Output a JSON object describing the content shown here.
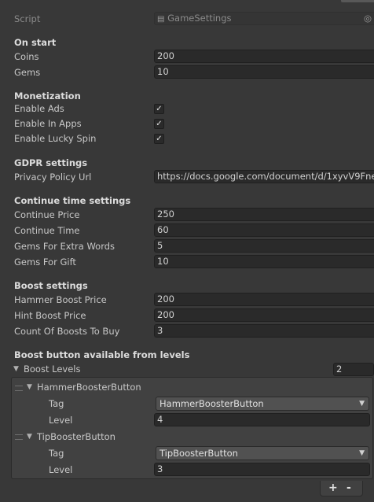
{
  "script_row": {
    "label": "Script",
    "value": "GameSettings"
  },
  "on_start": {
    "header": "On start",
    "coins": {
      "label": "Coins",
      "value": "200"
    },
    "gems": {
      "label": "Gems",
      "value": "10"
    }
  },
  "monetization": {
    "header": "Monetization",
    "enable_ads": {
      "label": "Enable Ads",
      "checked": true
    },
    "enable_in_apps": {
      "label": "Enable In Apps",
      "checked": true
    },
    "enable_lucky_spin": {
      "label": "Enable Lucky Spin",
      "checked": true
    }
  },
  "gdpr": {
    "header": "GDPR settings",
    "privacy_policy_url": {
      "label": "Privacy Policy Url",
      "value": "https://docs.google.com/document/d/1xyvV9Fne"
    }
  },
  "continue_time": {
    "header": "Continue time settings",
    "continue_price": {
      "label": "Continue Price",
      "value": "250"
    },
    "continue_time": {
      "label": "Continue Time",
      "value": "60"
    },
    "gems_for_extra_words": {
      "label": "Gems For Extra Words",
      "value": "5"
    },
    "gems_for_gift": {
      "label": "Gems For Gift",
      "value": "10"
    }
  },
  "boost": {
    "header": "Boost settings",
    "hammer_boost_price": {
      "label": "Hammer Boost Price",
      "value": "200"
    },
    "hint_boost_price": {
      "label": "Hint Boost Price",
      "value": "200"
    },
    "count_of_boosts_to_buy": {
      "label": "Count Of Boosts To Buy",
      "value": "3"
    }
  },
  "boost_levels": {
    "header": "Boost button available from levels",
    "list_label": "Boost Levels",
    "size": "2",
    "items": [
      {
        "name": "HammerBoosterButton",
        "tag_label": "Tag",
        "tag_value": "HammerBoosterButton",
        "level_label": "Level",
        "level_value": "4"
      },
      {
        "name": "TipBoosterButton",
        "tag_label": "Tag",
        "tag_value": "TipBoosterButton",
        "level_label": "Level",
        "level_value": "3"
      }
    ],
    "add_label": "+",
    "remove_label": "-"
  },
  "icons": {
    "check": "✓",
    "foldout_open": "▼",
    "dropdown_arrow": "▼",
    "target": "◎",
    "script_asset": "▤"
  }
}
